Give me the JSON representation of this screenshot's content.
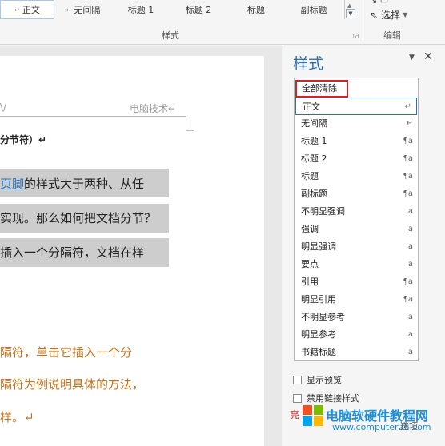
{
  "ribbon": {
    "gallery": [
      {
        "label": "正文",
        "mark": "↵",
        "selected": true
      },
      {
        "label": "无间隔",
        "mark": "↵",
        "selected": false
      },
      {
        "label": "标题 1",
        "mark": "",
        "selected": false
      },
      {
        "label": "标题 2",
        "mark": "",
        "selected": false
      },
      {
        "label": "标题",
        "mark": "",
        "selected": false
      },
      {
        "label": "副标题",
        "mark": "",
        "selected": false
      }
    ],
    "styles_group_label": "样式",
    "editing_group_label": "编辑",
    "select_label": "选择",
    "select_icon": "cursor-arrow-icon"
  },
  "document": {
    "header_left": "\\/",
    "header_right": "电脑技术↵",
    "bold_line": "分节符）↵",
    "lines": [
      {
        "pre_link": "",
        "link": "页脚",
        "text": "的样式大于两种、从任",
        "orange": false
      },
      {
        "pre_link": "",
        "link": "",
        "text": "实现。那么如何把文档分节？",
        "orange": false
      },
      {
        "pre_link": "",
        "link": "",
        "text": "插入一个分隔符，文档在样",
        "orange": false
      },
      {
        "pre_link": "",
        "link": "",
        "text": "隔符，单击它插入一个分",
        "orange": true
      },
      {
        "pre_link": "",
        "link": "",
        "text": "隔符为例说明具体的方法，",
        "orange": true
      },
      {
        "pre_link": "",
        "link": "",
        "text": "样。↵",
        "orange": true
      }
    ]
  },
  "pane": {
    "title": "样式",
    "items": [
      {
        "label": "全部清除",
        "indicator": ""
      },
      {
        "label": "正文",
        "indicator": "↵"
      },
      {
        "label": "无间隔",
        "indicator": "↵"
      },
      {
        "label": "标题 1",
        "indicator": "¶a"
      },
      {
        "label": "标题 2",
        "indicator": "¶a"
      },
      {
        "label": "标题",
        "indicator": "¶a"
      },
      {
        "label": "副标题",
        "indicator": "¶a"
      },
      {
        "label": "不明显强调",
        "indicator": "a"
      },
      {
        "label": "强调",
        "indicator": "a"
      },
      {
        "label": "明显强调",
        "indicator": "a"
      },
      {
        "label": "要点",
        "indicator": "a"
      },
      {
        "label": "引用",
        "indicator": "¶a"
      },
      {
        "label": "明显引用",
        "indicator": "¶a"
      },
      {
        "label": "不明显参考",
        "indicator": "a"
      },
      {
        "label": "明显参考",
        "indicator": "a"
      },
      {
        "label": "书籍标题",
        "indicator": "a"
      }
    ],
    "show_preview_label": "显示预览",
    "disable_linked_label": "禁用链接样式",
    "options_label": "选项"
  },
  "watermark": {
    "prefix": "亮",
    "title": "电脑软硬件教程网",
    "url": "www.computer26.com"
  },
  "colors": {
    "accent": "#2a6eb5",
    "highlight": "#cdcdcd",
    "orange_text": "#c8731b",
    "red_box": "#d12525"
  }
}
